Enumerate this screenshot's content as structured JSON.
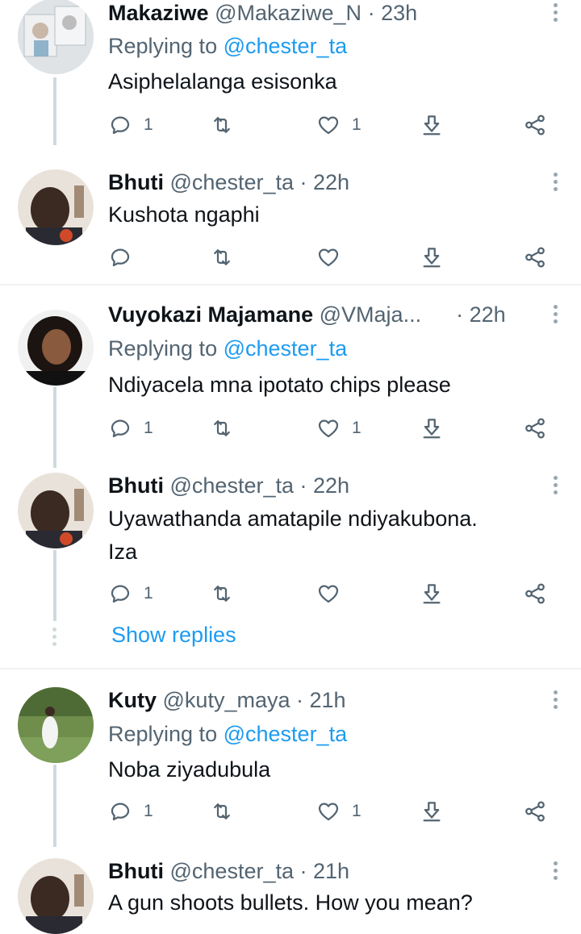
{
  "tweets": [
    {
      "name": "Makaziwe",
      "handle": "@Makaziwe_N",
      "dot": "·",
      "time": "23h",
      "replying_label": "Replying to",
      "replying_to": "@chester_ta",
      "text": "Asiphelalanga esisonka",
      "reply_count": "1",
      "retweet_count": "",
      "like_count": "1"
    },
    {
      "name": "Bhuti",
      "handle": "@chester_ta",
      "dot": "·",
      "time": "22h",
      "text": "Kushota ngaphi",
      "reply_count": "",
      "retweet_count": "",
      "like_count": ""
    },
    {
      "name": "Vuyokazi Majamane",
      "handle": "@VMaja...",
      "dot": "·",
      "time": "22h",
      "replying_label": "Replying to",
      "replying_to": "@chester_ta",
      "text": "Ndiyacela mna ipotato chips please",
      "reply_count": "1",
      "retweet_count": "",
      "like_count": "1"
    },
    {
      "name": "Bhuti",
      "handle": "@chester_ta",
      "dot": "·",
      "time": "22h",
      "text": "Uyawathanda amatapile ndiyakubona.",
      "text2": "Iza",
      "reply_count": "1",
      "retweet_count": "",
      "like_count": ""
    },
    {
      "name": "Kuty",
      "handle": "@kuty_maya",
      "dot": "·",
      "time": "21h",
      "replying_label": "Replying to",
      "replying_to": "@chester_ta",
      "text": "Noba ziyadubula",
      "reply_count": "1",
      "retweet_count": "",
      "like_count": "1"
    },
    {
      "name": "Bhuti",
      "handle": "@chester_ta",
      "dot": "·",
      "time": "21h",
      "text": "A gun shoots bullets. How you mean?"
    }
  ],
  "show_replies": "Show replies",
  "icons": {
    "reply": "reply-icon",
    "retweet": "retweet-icon",
    "like": "heart-icon",
    "share": "share-icon",
    "download": "download-icon",
    "more": "more-icon"
  },
  "colors": {
    "link": "#1d9bf0",
    "muted": "#536471",
    "thread_line": "#cfd9de"
  }
}
